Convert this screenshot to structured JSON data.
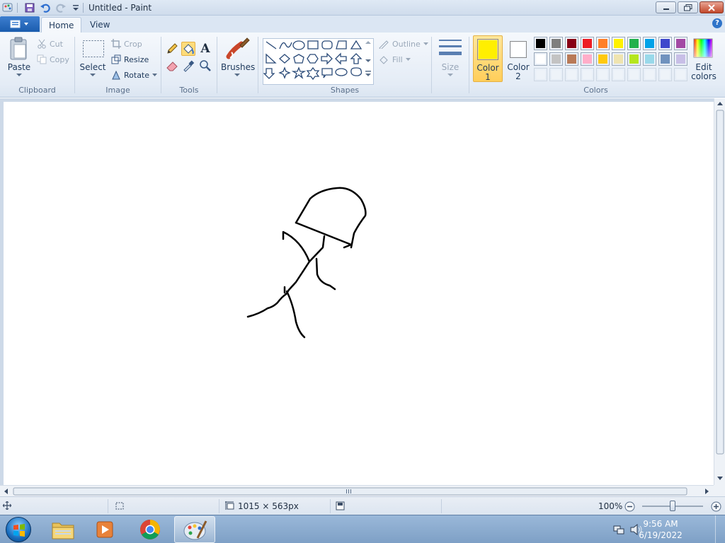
{
  "window": {
    "title": "Untitled - Paint"
  },
  "tabs": [
    {
      "label": "Home",
      "active": true
    },
    {
      "label": "View",
      "active": false
    }
  ],
  "clipboard": {
    "group_label": "Clipboard",
    "paste": "Paste",
    "cut": "Cut",
    "copy": "Copy"
  },
  "image": {
    "group_label": "Image",
    "select": "Select",
    "crop": "Crop",
    "resize": "Resize",
    "rotate": "Rotate"
  },
  "tools": {
    "group_label": "Tools",
    "text_glyph": "A"
  },
  "brushes": {
    "label": "Brushes"
  },
  "shapes": {
    "group_label": "Shapes",
    "outline": "Outline",
    "fill": "Fill"
  },
  "size": {
    "label": "Size"
  },
  "colors": {
    "group_label": "Colors",
    "color1_line1": "Color",
    "color1_line2": "1",
    "color2_line1": "Color",
    "color2_line2": "2",
    "edit_line1": "Edit",
    "edit_line2": "colors",
    "color1_value": "#ffef00",
    "color2_value": "#ffffff",
    "palette_row1": [
      "#000000",
      "#7f7f7f",
      "#880015",
      "#ed1c24",
      "#ff7f27",
      "#fff200",
      "#22b14c",
      "#00a2e8",
      "#3f48cc",
      "#a349a4"
    ],
    "palette_row2": [
      "#ffffff",
      "#c3c3c3",
      "#b97a57",
      "#ffaec9",
      "#ffc90e",
      "#efe4b0",
      "#b5e61d",
      "#99d9ea",
      "#7092be",
      "#c8bfe7"
    ],
    "palette_row3": [
      "#ffffff",
      "#ffffff",
      "#ffffff",
      "#ffffff",
      "#ffffff",
      "#ffffff",
      "#ffffff",
      "#ffffff",
      "#ffffff",
      "#ffffff"
    ]
  },
  "status": {
    "canvas_size": "1015 × 563px",
    "zoom": "100%",
    "zoom_fraction": 0.5
  },
  "taskbar": {
    "time": "9:56 AM",
    "date": "6/19/2022"
  }
}
